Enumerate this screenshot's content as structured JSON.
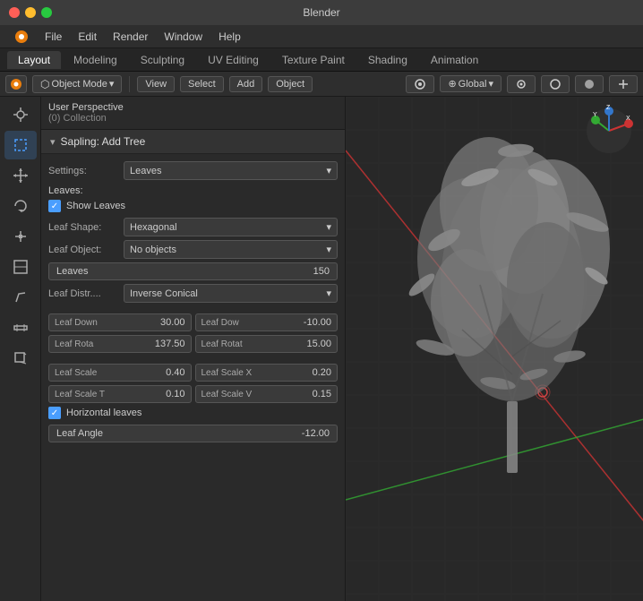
{
  "window": {
    "title": "Blender",
    "controls": {
      "close": "close",
      "minimize": "minimize",
      "maximize": "maximize"
    }
  },
  "menu": {
    "items": [
      "Blender",
      "File",
      "Edit",
      "Render",
      "Window",
      "Help"
    ]
  },
  "workspace_tabs": [
    {
      "id": "layout",
      "label": "Layout",
      "active": true
    },
    {
      "id": "modeling",
      "label": "Modeling",
      "active": false
    },
    {
      "id": "sculpting",
      "label": "Sculpting",
      "active": false
    },
    {
      "id": "uv_editing",
      "label": "UV Editing",
      "active": false
    },
    {
      "id": "texture_paint",
      "label": "Texture Paint",
      "active": false
    },
    {
      "id": "shading",
      "label": "Shading",
      "active": false
    },
    {
      "id": "animation",
      "label": "Animation",
      "active": false
    }
  ],
  "toolbar": {
    "mode": "Object Mode",
    "view": "View",
    "select": "Select",
    "add": "Add",
    "object": "Object",
    "transform": "Global"
  },
  "sidebar_icons": [
    {
      "name": "cursor-icon",
      "symbol": "⊕",
      "active": false
    },
    {
      "name": "select-icon",
      "symbol": "◻",
      "active": true
    },
    {
      "name": "move-icon",
      "symbol": "✛",
      "active": false
    },
    {
      "name": "rotate-icon",
      "symbol": "↺",
      "active": false
    },
    {
      "name": "scale-icon",
      "symbol": "⤡",
      "active": false
    },
    {
      "name": "transform-icon",
      "symbol": "⊞",
      "active": false
    },
    {
      "name": "annotate-icon",
      "symbol": "✏",
      "active": false
    },
    {
      "name": "measure-icon",
      "symbol": "📏",
      "active": false
    },
    {
      "name": "add-cube-icon",
      "symbol": "⬡",
      "active": false
    }
  ],
  "viewport": {
    "mode": "User Perspective",
    "collection": "(0) Collection",
    "accent_color": "#4a9eff"
  },
  "panel": {
    "title": "Sapling: Add Tree",
    "settings_label": "Settings:",
    "settings_value": "Leaves",
    "section_title": "Leaves:",
    "show_leaves_label": "Show Leaves",
    "show_leaves_checked": true,
    "leaf_shape_label": "Leaf Shape:",
    "leaf_shape_value": "Hexagonal",
    "leaf_object_label": "Leaf Object:",
    "leaf_object_value": "No objects",
    "leaves_label": "Leaves",
    "leaves_value": "150",
    "leaf_distr_label": "Leaf Distr....",
    "leaf_distr_value": "Inverse Conical",
    "leaf_down_label": "Leaf Down",
    "leaf_down_value": "30.00",
    "leaf_dow_label": "Leaf Dow",
    "leaf_dow_value": "-10.00",
    "leaf_rota_label": "Leaf Rota",
    "leaf_rota_value": "137.50",
    "leaf_rotat_label": "Leaf Rotat",
    "leaf_rotat_value": "15.00",
    "leaf_scale_label": "Leaf Scale",
    "leaf_scale_value": "0.40",
    "leaf_scale_x_label": "Leaf Scale X",
    "leaf_scale_x_value": "0.20",
    "leaf_scale_t_label": "Leaf Scale T",
    "leaf_scale_t_value": "0.10",
    "leaf_scale_v_label": "Leaf Scale V",
    "leaf_scale_v_value": "0.15",
    "horizontal_leaves_label": "Horizontal leaves",
    "horizontal_leaves_checked": true,
    "leaf_angle_label": "Leaf Angle",
    "leaf_angle_value": "-12.00"
  }
}
